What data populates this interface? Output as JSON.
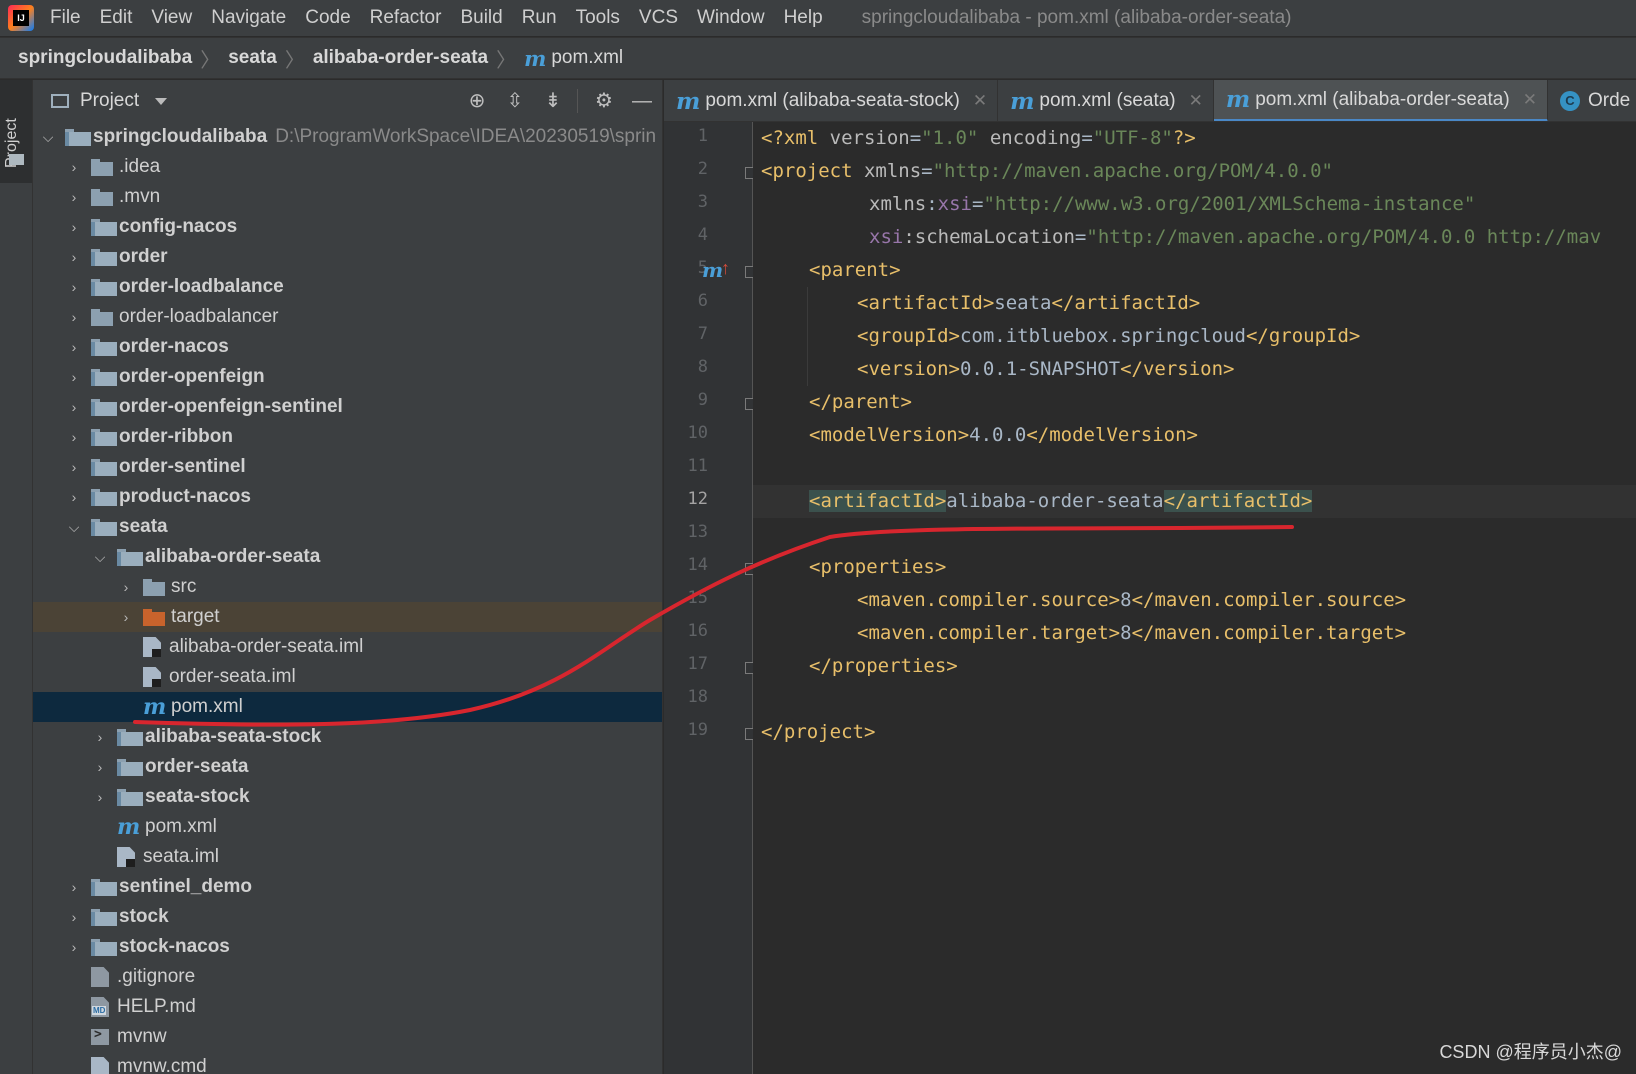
{
  "menu": {
    "items": [
      "File",
      "Edit",
      "View",
      "Navigate",
      "Code",
      "Refactor",
      "Build",
      "Run",
      "Tools",
      "VCS",
      "Window",
      "Help"
    ],
    "window_title": "springcloudalibaba - pom.xml (alibaba-order-seata)"
  },
  "breadcrumb": [
    "springcloudalibaba",
    "seata",
    "alibaba-order-seata",
    "pom.xml"
  ],
  "left_stripe": {
    "label": "Project"
  },
  "project_panel": {
    "title": "Project",
    "root": {
      "label": "springcloudalibaba",
      "path": "D:\\ProgramWorkSpace\\IDEA\\20230519\\sprin"
    },
    "nodes": [
      {
        "label": ".idea"
      },
      {
        "label": ".mvn"
      },
      {
        "label": "config-nacos"
      },
      {
        "label": "order"
      },
      {
        "label": "order-loadbalance"
      },
      {
        "label": "order-loadbalancer"
      },
      {
        "label": "order-nacos"
      },
      {
        "label": "order-openfeign"
      },
      {
        "label": "order-openfeign-sentinel"
      },
      {
        "label": "order-ribbon"
      },
      {
        "label": "order-sentinel"
      },
      {
        "label": "product-nacos"
      },
      {
        "label": "seata"
      },
      {
        "label": "alibaba-order-seata"
      },
      {
        "label": "src"
      },
      {
        "label": "target"
      },
      {
        "label": "alibaba-order-seata.iml"
      },
      {
        "label": "order-seata.iml"
      },
      {
        "label": "pom.xml"
      },
      {
        "label": "alibaba-seata-stock"
      },
      {
        "label": "order-seata"
      },
      {
        "label": "seata-stock"
      },
      {
        "label": "pom.xml"
      },
      {
        "label": "seata.iml"
      },
      {
        "label": "sentinel_demo"
      },
      {
        "label": "stock"
      },
      {
        "label": "stock-nacos"
      },
      {
        "label": ".gitignore"
      },
      {
        "label": "HELP.md"
      },
      {
        "label": "mvnw"
      },
      {
        "label": "mvnw.cmd"
      }
    ]
  },
  "editor": {
    "tabs": [
      {
        "label": "pom.xml (alibaba-seata-stock)"
      },
      {
        "label": "pom.xml (seata)"
      },
      {
        "label": "pom.xml (alibaba-order-seata)"
      },
      {
        "label": "Orde"
      }
    ],
    "current_line": "12",
    "line_numbers": [
      "1",
      "2",
      "3",
      "4",
      "5",
      "6",
      "7",
      "8",
      "9",
      "10",
      "11",
      "12",
      "13",
      "14",
      "15",
      "16",
      "17",
      "18",
      "19"
    ],
    "code": {
      "l1": {
        "open": "<?xml",
        "a1": " version",
        "eq1": "=",
        "v1": "\"1.0\"",
        "a2": " encoding",
        "eq2": "=",
        "v2": "\"UTF-8\"",
        "close": "?>"
      },
      "l2": {
        "open": "<project",
        "a1": " xmlns",
        "eq": "=",
        "v": "\"http://maven.apache.org/POM/4.0.0\""
      },
      "l3": {
        "pre": "xmlns",
        "colon": ":",
        "ns": "xsi",
        "eq": "=",
        "v": "\"http://www.w3.org/2001/XMLSchema-instance\""
      },
      "l4": {
        "ns": "xsi",
        "attr": ":schemaLocation",
        "eq": "=",
        "v": "\"http://maven.apache.org/POM/4.0.0 http://mav"
      },
      "l5": {
        "tag": "<parent>"
      },
      "l6": {
        "open": "<artifactId>",
        "text": "seata",
        "close": "</artifactId>"
      },
      "l7": {
        "open": "<groupId>",
        "text": "com.itbluebox.springcloud",
        "close": "</groupId>"
      },
      "l8": {
        "open": "<version>",
        "text": "0.0.1-SNAPSHOT",
        "close": "</version>"
      },
      "l9": {
        "tag": "</parent>"
      },
      "l10": {
        "open": "<modelVersion>",
        "text": "4.0.0",
        "close": "</modelVersion>"
      },
      "l12": {
        "open": "<artifactId>",
        "text": "alibaba-order-seata",
        "close": "</artifactId>"
      },
      "l14": {
        "tag": "<properties>"
      },
      "l15": {
        "open": "<maven.compiler.source>",
        "text": "8",
        "close": "</maven.compiler.source>"
      },
      "l16": {
        "open": "<maven.compiler.target>",
        "text": "8",
        "close": "</maven.compiler.target>"
      },
      "l17": {
        "tag": "</properties>"
      },
      "l19": {
        "tag": "</project>"
      }
    }
  },
  "watermark": "CSDN @程序员小杰@",
  "colors": {
    "annotation": "#d8262e",
    "selection": "#0d293e",
    "accent": "#4a88c7"
  }
}
